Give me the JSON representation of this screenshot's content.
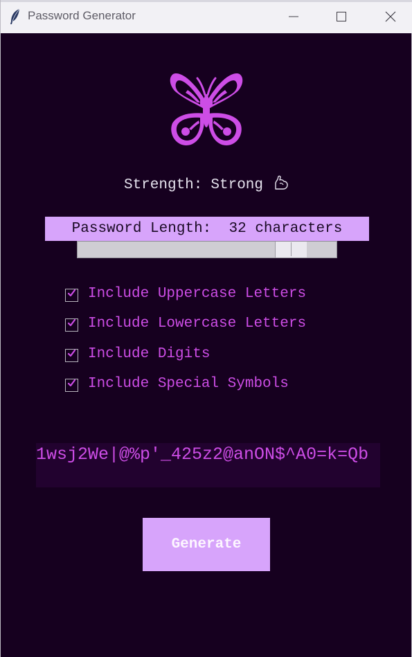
{
  "window": {
    "title": "Password Generator",
    "icon": "feather-icon",
    "controls": [
      "minimize-icon",
      "maximize-icon",
      "close-icon"
    ]
  },
  "logo": {
    "icon": "butterfly-icon",
    "color": "#cd4de6"
  },
  "strength": {
    "label": "Strength:",
    "value": "Strong",
    "icon": "flexed-biceps-icon"
  },
  "length": {
    "label": "Password Length:",
    "value": "32",
    "unit": "characters",
    "slider_fraction": 0.87
  },
  "options": [
    {
      "label": "Include Uppercase Letters",
      "checked": true
    },
    {
      "label": "Include Lowercase Letters",
      "checked": true
    },
    {
      "label": "Include Digits",
      "checked": true
    },
    {
      "label": "Include Special Symbols",
      "checked": true
    }
  ],
  "password": {
    "value": "1wsj2We|@%p'_425z2@anON$^A0=k=Qb"
  },
  "generate": {
    "label": "Generate"
  },
  "colors": {
    "background": "#16001f",
    "accent": "#cd4de6",
    "button": "#d7a4fb",
    "text": "#e7e4ef"
  }
}
